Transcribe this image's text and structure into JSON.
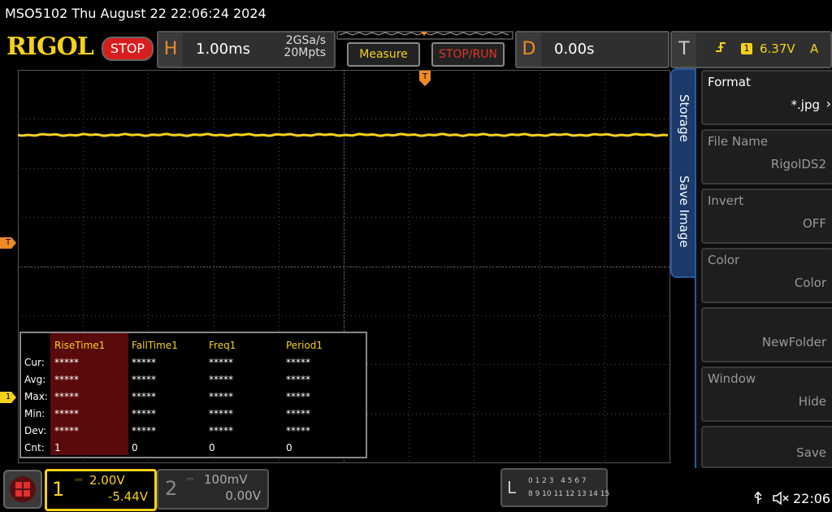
{
  "header": {
    "title": "MSO5102  Thu August 22 22:06:24 2024",
    "logo": "RIGOL",
    "run_state": "STOP"
  },
  "horizontal": {
    "letter": "H",
    "timebase": "1.00ms",
    "sample_rate": "2GSa/s",
    "memory_depth": "20Mpts"
  },
  "buttons": {
    "measure": "Measure",
    "stop_run": "STOP/RUN"
  },
  "delay": {
    "letter": "D",
    "value": "0.00s"
  },
  "trigger": {
    "letter": "T",
    "edge_icon": "rising-edge-icon",
    "source": "1",
    "level": "6.37V",
    "mode": "A"
  },
  "markers": {
    "trigger_level": "T",
    "channel1": "1"
  },
  "measurements": {
    "columns": [
      "RiseTime1",
      "FallTime1",
      "Freq1",
      "Period1"
    ],
    "rows": [
      {
        "label": "Cur:",
        "values": [
          "*****",
          "*****",
          "*****",
          "*****"
        ]
      },
      {
        "label": "Avg:",
        "values": [
          "*****",
          "*****",
          "*****",
          "*****"
        ]
      },
      {
        "label": "Max:",
        "values": [
          "*****",
          "*****",
          "*****",
          "*****"
        ]
      },
      {
        "label": "Min:",
        "values": [
          "*****",
          "*****",
          "*****",
          "*****"
        ]
      },
      {
        "label": "Dev:",
        "values": [
          "*****",
          "*****",
          "*****",
          "*****"
        ]
      },
      {
        "label": "Cnt:",
        "values": [
          "1",
          "0",
          "0",
          "0"
        ]
      }
    ]
  },
  "side_menu": {
    "tab_top": "Storage",
    "tab_bottom": "Save Image",
    "items": [
      {
        "label": "Format",
        "value": "*.jpg"
      },
      {
        "label": "File Name",
        "value": "RigolDS2"
      },
      {
        "label": "Invert",
        "value": "OFF"
      },
      {
        "label": "Color",
        "value": "Color"
      },
      {
        "label": "",
        "value": "NewFolder"
      },
      {
        "label": "Window",
        "value": "Hide"
      },
      {
        "label": "",
        "value": "Save"
      }
    ]
  },
  "channels": {
    "ch1": {
      "num": "1",
      "scale": "2.00V",
      "offset": "-5.44V"
    },
    "ch2": {
      "num": "2",
      "scale": "100mV",
      "offset": "0.00V"
    }
  },
  "logic": {
    "letter": "L",
    "row1": "0 1 2 3   4 5 6 7",
    "row2": "8 9 10 11 12 13 14 15"
  },
  "status": {
    "time": "22:06"
  },
  "colors": {
    "ch1": "#f5d21a",
    "trigger": "#f08a24",
    "grid": "#555555",
    "menu_accent": "#2a5aa0"
  }
}
